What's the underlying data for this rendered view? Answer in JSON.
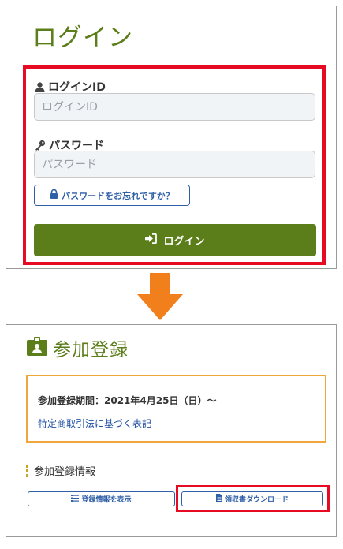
{
  "login": {
    "title": "ログイン",
    "id_label": "ログインID",
    "id_placeholder": "ログインID",
    "id_value": "",
    "password_label": "パスワード",
    "password_placeholder": "パスワード",
    "password_value": "",
    "forgot_label": "パスワードをお忘れですか？",
    "submit_label": "ログイン"
  },
  "registration": {
    "title": "参加登録",
    "period": "参加登録期間：2021年4月25日（日）～",
    "law_link": "特定商取引法に基づく表記",
    "section_title": "参加登録情報",
    "info_button": "登録情報を表示",
    "receipt_button": "領収書ダウンロード"
  },
  "icons": {
    "user": "user-icon",
    "key": "key-icon",
    "lock": "lock-icon",
    "sign_in": "sign-in-icon",
    "arrow": "arrow-down-icon",
    "badge": "id-badge-icon",
    "list": "list-icon",
    "file": "file-icon"
  },
  "colors": {
    "brand_green": "#5b7d1a",
    "highlight_red": "#e60b23",
    "link_blue": "#2f5fa7",
    "notice_orange": "#efa63a",
    "arrow_orange": "#f07f1c"
  }
}
